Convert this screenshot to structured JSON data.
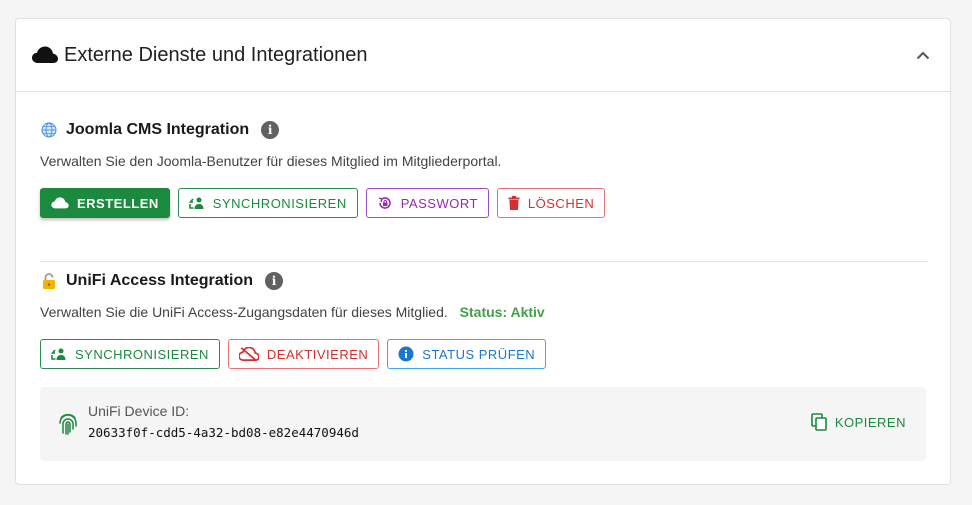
{
  "panel": {
    "title": "Externe Dienste und Integrationen",
    "icon": "cloud-icon"
  },
  "joomla": {
    "title": "Joomla CMS Integration",
    "icon": "globe-icon",
    "description": "Verwalten Sie den Joomla-Benutzer für dieses Mitglied im Mitgliederportal.",
    "buttons": {
      "create": "ERSTELLEN",
      "sync": "SYNCHRONISIEREN",
      "password": "PASSWORT",
      "delete": "LÖSCHEN"
    }
  },
  "unifi": {
    "title": "UniFi Access Integration",
    "icon": "lock-icon",
    "description": "Verwalten Sie die UniFi Access-Zugangsdaten für dieses Mitglied.",
    "status": "Status: Aktiv",
    "buttons": {
      "sync": "SYNCHRONISIEREN",
      "deactivate": "DEAKTIVIEREN",
      "check": "STATUS PRÜFEN"
    },
    "device": {
      "label": "UniFi Device ID:",
      "id": "20633f0f-cdd5-4a32-bd08-e82e4470946d",
      "copy": "KOPIEREN"
    }
  },
  "colors": {
    "primary_green": "#1b8a3e",
    "status_green": "#43a047",
    "purple": "#9c27b0",
    "red": "#d32f2f",
    "blue": "#1976d2"
  }
}
